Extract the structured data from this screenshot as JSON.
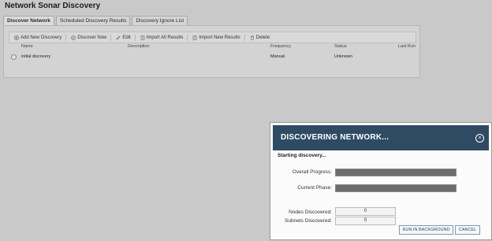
{
  "page": {
    "title": "Network Sonar Discovery"
  },
  "tabs": [
    {
      "label": "Discover Network",
      "active": true
    },
    {
      "label": "Scheduled Discovery Results",
      "active": false
    },
    {
      "label": "Discovery Ignore List",
      "active": false
    }
  ],
  "toolbar": {
    "add_label": "Add New Discovery",
    "discover_now_label": "Discover Now",
    "edit_label": "Edit",
    "import_all_label": "Import All Results",
    "import_new_label": "Import New Results",
    "delete_label": "Delete"
  },
  "grid": {
    "columns": [
      "Name",
      "Description",
      "Frequency",
      "Status",
      "Last Run"
    ],
    "rows": [
      {
        "name": "initial discovery",
        "description": "",
        "frequency": "Manual",
        "status": "Unknown",
        "last_run": ""
      }
    ]
  },
  "dialog": {
    "title": "DISCOVERING NETWORK...",
    "status": "Starting discovery...",
    "overall_progress_label": "Overall Progress:",
    "current_phase_label": "Current Phase:",
    "nodes_label": "Nodes Discovered:",
    "subnets_label": "Subnets Discovered:",
    "nodes_value": "0",
    "subnets_value": "0",
    "run_background_label": "RUN IN BACKGROUND",
    "cancel_label": "CANCEL",
    "close_glyph": "×"
  },
  "colors": {
    "header": "#2e4b63",
    "bar": "#6d6d6d",
    "overlay": "#c9c9c9"
  }
}
